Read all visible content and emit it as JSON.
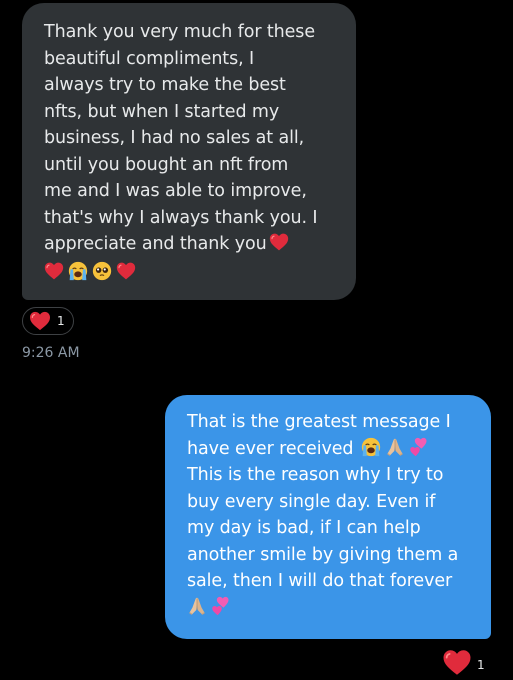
{
  "incoming_message": {
    "lines": [
      "Thank you very much for these",
      "beautiful compliments, I",
      "always try to make the best",
      "nfts, but when I started my",
      "business, I had no sales at all,",
      "until you bought an nft from",
      "me and I was able to improve,",
      "that's why I always thank you. I",
      "appreciate and thank you"
    ],
    "trailing_emoji_line1": [
      "red-heart"
    ],
    "emoji_line": [
      "red-heart",
      "loudly-crying-face",
      "pleading-face",
      "red-heart"
    ],
    "reaction": {
      "icon": "red-heart",
      "count": "1"
    },
    "timestamp": "9:26 AM"
  },
  "outgoing_message": {
    "lines": [
      "That is the greatest message I",
      "have ever received",
      "This is the reason why I try to",
      "buy every single day. Even if",
      "my day is bad, if I can help",
      "another smile by giving them a",
      "sale, then I will do that forever"
    ],
    "line2_emoji": [
      "loudly-crying-face",
      "folded-hands",
      "two-hearts"
    ],
    "last_emoji_line": [
      "folded-hands",
      "two-hearts"
    ],
    "reaction": {
      "icon": "red-heart",
      "count": "1"
    }
  },
  "colors": {
    "background": "#000000",
    "incoming_bubble": "#2f3336",
    "outgoing_bubble": "#3b95e8",
    "heart": "#e0245e",
    "muted_text": "#8b98a5"
  }
}
